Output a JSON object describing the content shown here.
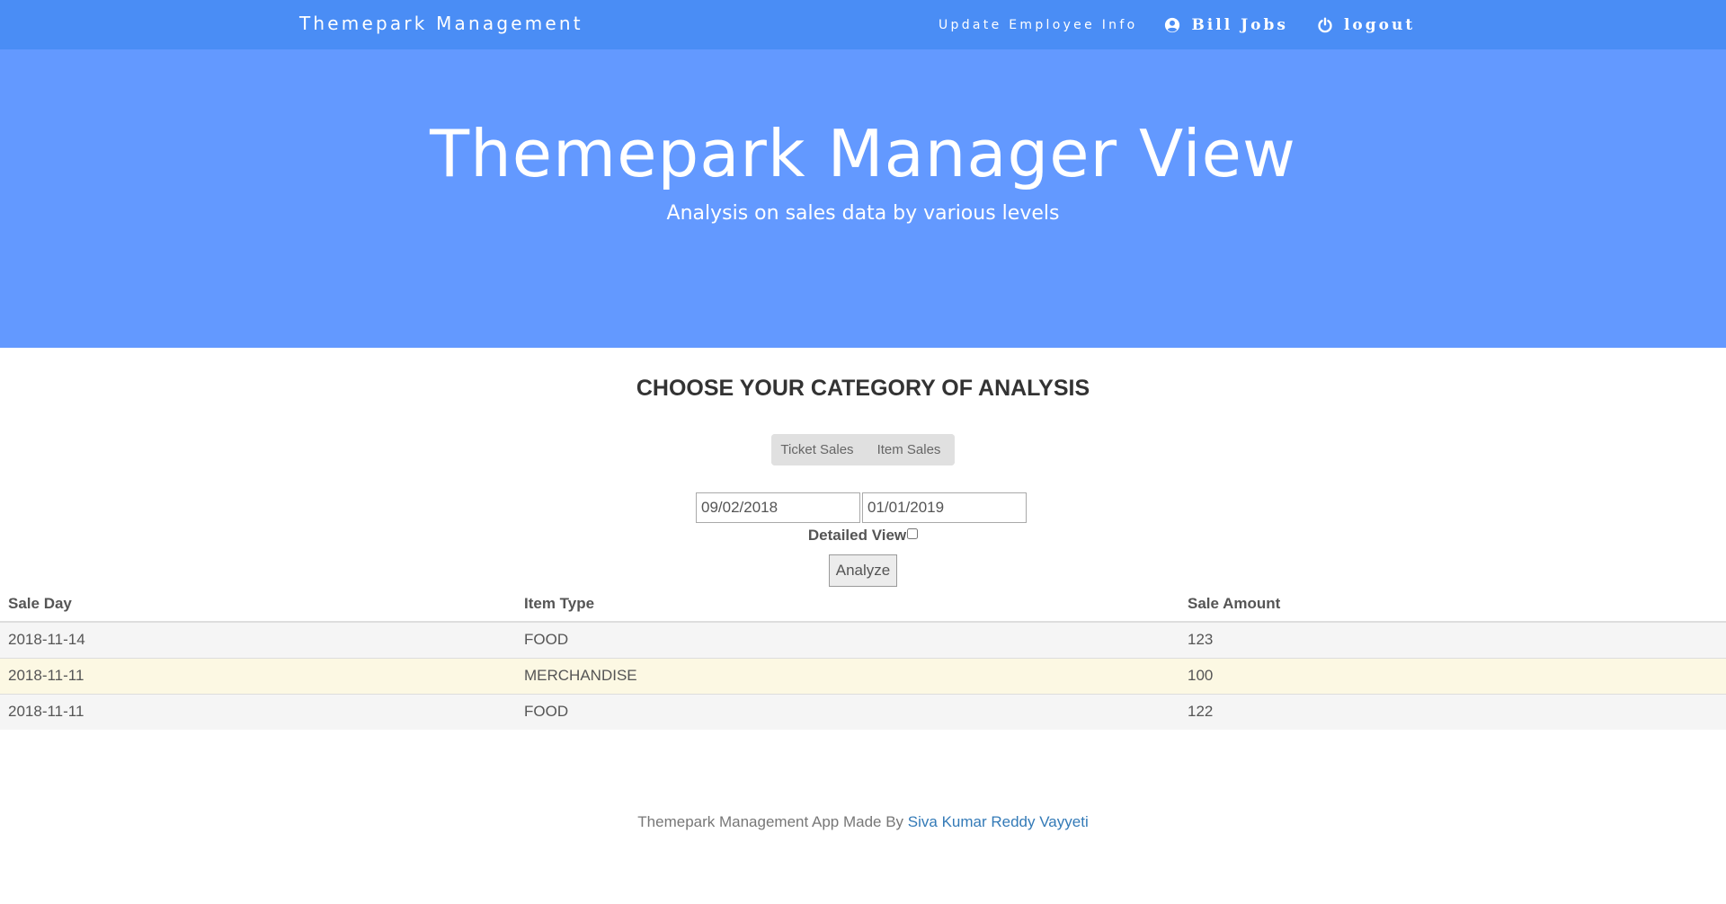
{
  "navbar": {
    "brand": "Themepark Management",
    "update_link": "Update Employee Info",
    "user_name": "Bill Jobs",
    "user_icon": "user-circle-icon",
    "logout_label": "logout",
    "logout_icon": "power-icon",
    "background_color": "#4a8df5"
  },
  "hero": {
    "title": "Themepark Manager View",
    "subtitle": "Analysis on sales data by various levels",
    "background_color": "#6399ff"
  },
  "analysis": {
    "heading": "CHOOSE YOUR CATEGORY OF ANALYSIS",
    "categories": [
      {
        "label": "Ticket Sales"
      },
      {
        "label": "Item Sales"
      }
    ],
    "start_date": "09/02/2018",
    "end_date": "01/01/2019",
    "detailed_view_label": "Detailed View",
    "detailed_view_checked": false,
    "analyze_label": "Analyze"
  },
  "table": {
    "headers": [
      "Sale Day",
      "Item Type",
      "Sale Amount"
    ],
    "rows": [
      [
        "2018-11-14",
        "FOOD",
        "123"
      ],
      [
        "2018-11-11",
        "MERCHANDISE",
        "100"
      ],
      [
        "2018-11-11",
        "FOOD",
        "122"
      ]
    ],
    "row_colors": [
      "#f5f5f5",
      "#fcf8e3"
    ]
  },
  "footer": {
    "text": "Themepark Management App Made By ",
    "author": "Siva Kumar Reddy Vayyeti",
    "link_color": "#337ab7"
  }
}
